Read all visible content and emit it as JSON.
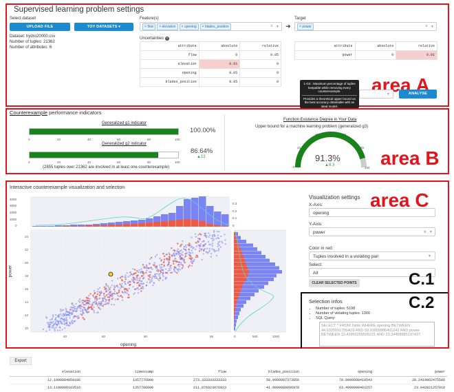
{
  "areaA": {
    "title": "Supervised learning problem settings",
    "select_dataset_label": "Select dataset",
    "upload_button": "UPLOAD FILE",
    "toy_button": "TOY DATASETS ▾",
    "dataset_info": [
      "Dataset: hydro20000.csv",
      "Number of tuples: 21362",
      "Number of attributes: 6"
    ],
    "features_label": "Feature(s)",
    "features": [
      "flow",
      "elevation",
      "opening",
      "blades_position"
    ],
    "target_label": "Target",
    "target": [
      "power"
    ],
    "uncertainties_label": "Uncertainties",
    "unc_headers": [
      "attribute",
      "absolute",
      "relative"
    ],
    "unc_rows": [
      [
        "flow",
        "0",
        "0.05"
      ],
      [
        "elevation",
        "0.01",
        "0"
      ],
      [
        "opening",
        "0.05",
        "0"
      ],
      [
        "blades_position",
        "0.05",
        "0"
      ]
    ],
    "target_headers": [
      "attribute",
      "absolute",
      "relative"
    ],
    "target_row": [
      "power",
      "0",
      "0.01"
    ],
    "tooltip": "1-G3 : Maximum percentage of tuples keepable while removing every counterexample.",
    "tooltip2": "Provides a theoretical upper bound on the best accuracy obtainable with an ideal model.",
    "analyse_button": "ANALYSE",
    "area_label": "area A"
  },
  "areaB": {
    "title_link": "Counterexample",
    "title_rest": " performance indicators",
    "g1_label": "Generalized g1 indicator",
    "g1_value": "100.00%",
    "g1_fraction": 1.0,
    "g2_label": "Generalized g2 indicator",
    "g2_value": "86.64%",
    "g2_delta": "▲13",
    "g2_fraction": 0.8664,
    "bar_ticks": [
      "0",
      "20",
      "40",
      "60",
      "80",
      "100"
    ],
    "involved_text": "(2855 tuples over 21362 are involved in at least one counterexample)",
    "fed_title": "Function Existence Degree in Your Data",
    "fed_sub": "Upper bound for a machine learning problem (generalized g3)",
    "gauge_value": "91.3%",
    "gauge_delta": "▲8.3",
    "gauge_fraction": 0.913,
    "gauge_ticks": [
      "0",
      "20",
      "40",
      "60",
      "80",
      "100"
    ],
    "area_label": "area B"
  },
  "areaC": {
    "title": "Interactive counterexample visualization and selection",
    "xaxis_label": "opening",
    "yaxis_label": "power",
    "top_hist_yticks": [
      "4000",
      "3000",
      "2000",
      "1000",
      "0"
    ],
    "top_hist_y2ticks": [
      "0.3",
      "0.2",
      "0.1",
      "0"
    ],
    "scatter_yticks": [
      "24",
      "22",
      "20",
      "18",
      "16",
      "14",
      "12",
      "10"
    ],
    "scatter_xticks": [
      "40",
      "60",
      "80",
      "95"
    ],
    "right_hist_xticks": [
      "0",
      "500",
      "1000"
    ],
    "viz_title": "Visualization settings",
    "xaxis_select_label": "X-Axis:",
    "xaxis_value": "opening",
    "yaxis_select_label": "Y-Axis:",
    "yaxis_value": "power",
    "color_label": "Color in red:",
    "color_value": "Tuples involved in a violating pair",
    "select_label": "Select:",
    "select_value": "All",
    "clear_button": "CLEAR SELECTED POINTS",
    "c1_label": "C.1",
    "c2_label": "C.2",
    "sel_title": "Selection infos",
    "sel_items": [
      "Number of tuples: 5198",
      "Number of violating tuples: 1300",
      "SQL Query:"
    ],
    "sql": "SELECT * FROM Table WHERE opening BETWEEN 44.63355917554O9 AND 59.93959986401242 AND power BETWEEN 13.42966359506221 AND 23.34498985197437",
    "area_label": "area C"
  },
  "export": {
    "button": "Export",
    "headers": [
      "elevation",
      "timestamp",
      "flow",
      "blades_position",
      "opening",
      "power"
    ],
    "rows": [
      [
        "12.1898084859186",
        "1357776000",
        "273.333333333333",
        "58.9999997373956",
        "70.9999998410543",
        "28.2419862475586"
      ],
      [
        "13.1100006103516",
        "1357786000",
        "211.876923076923",
        "41.9999980096978",
        "63.4999998403257",
        "23.042921257019"
      ]
    ]
  }
}
